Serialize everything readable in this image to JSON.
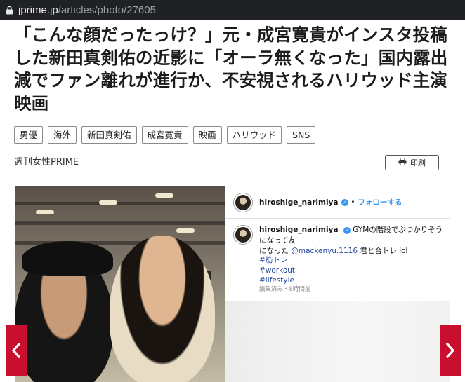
{
  "browser": {
    "url_host": "jprime.jp",
    "url_path": "/articles/photo/27605"
  },
  "article": {
    "headline": "「こんな顔だったっけ？」元・成宮寛貴がインスタ投稿した新田真剣佑の近影に「オーラ無くなった」国内露出減でファン離れが進行か、不安視されるハリウッド主演映画",
    "tags": [
      "男優",
      "海外",
      "新田真剣佑",
      "成宮寛貴",
      "映画",
      "ハリウッド",
      "SNS"
    ],
    "source": "週刊女性PRIME",
    "print_label": "印刷"
  },
  "instagram": {
    "username": "hiroshige_narimiya",
    "follow": "フォローする",
    "caption_user": "hiroshige_narimiya",
    "caption_line1": "GYMの階段でぶつかりそうになって友",
    "caption_line2_pre": "になった ",
    "caption_mention": "@mackenyu.1116",
    "caption_line2_post": " 君と合トレ lol",
    "hashtags": [
      "#筋トレ",
      "#workout",
      "#lifestyle"
    ],
    "edited": "編集済み・8時間前"
  },
  "icons": [
    "lock-icon",
    "print-icon",
    "verified-icon",
    "chevron-left-icon",
    "chevron-right-icon"
  ],
  "colors": {
    "accent_red": "#c8102e",
    "link_blue": "#3897f0",
    "hashtag_blue": "#21459a"
  }
}
